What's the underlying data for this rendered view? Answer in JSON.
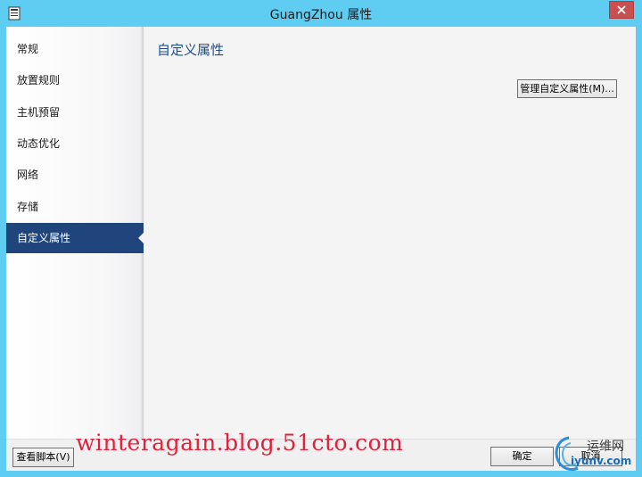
{
  "window": {
    "title": "GuangZhou 属性",
    "close_symbol": "✕"
  },
  "sidebar": {
    "items": [
      {
        "label": "常规",
        "selected": false
      },
      {
        "label": "放置规则",
        "selected": false
      },
      {
        "label": "主机预留",
        "selected": false
      },
      {
        "label": "动态优化",
        "selected": false
      },
      {
        "label": "网络",
        "selected": false
      },
      {
        "label": "存储",
        "selected": false
      },
      {
        "label": "自定义属性",
        "selected": true
      }
    ]
  },
  "main": {
    "section_title": "自定义属性",
    "manage_button_label": "管理自定义属性(M)..."
  },
  "footer": {
    "view_script_label": "查看脚本(V)",
    "ok_label": "确定",
    "cancel_label": "取消"
  },
  "watermark": {
    "text": "winteragain.blog.51cto.com",
    "logo_cn": "运维网",
    "logo_url": "iyunv.com"
  },
  "colors": {
    "window_frame": "#5fcdf2",
    "selected_nav": "#20457c",
    "section_title": "#1f4e8c",
    "close_button": "#c75050",
    "watermark_red": "#e0213b"
  },
  "icons": {
    "system": "window-app-icon",
    "close": "close-icon"
  }
}
